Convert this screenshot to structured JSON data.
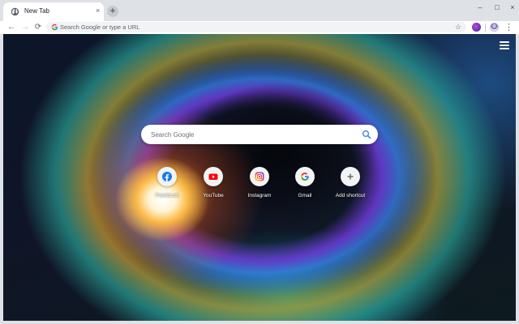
{
  "browser": {
    "tab": {
      "title": "New Tab",
      "close": "×"
    },
    "new_tab": "+",
    "window_controls": {
      "minimize": "–",
      "maximize": "□",
      "close": "×"
    },
    "nav": {
      "back": "←",
      "forward": "→",
      "reload": "⟳"
    },
    "omnibox": {
      "placeholder": "Search Google or type a URL",
      "star": "☆"
    },
    "menu": "⋮"
  },
  "newtab_page": {
    "search": {
      "placeholder": "Search Google"
    },
    "shortcuts": [
      {
        "label": "Facebook",
        "icon": "facebook-icon",
        "color": "#1877f2"
      },
      {
        "label": "YouTube",
        "icon": "youtube-icon",
        "color": "#ff0000"
      },
      {
        "label": "Instagram",
        "icon": "instagram-icon",
        "color": "#c13584"
      },
      {
        "label": "Gmail",
        "icon": "google-g-icon",
        "color": "#4285f4"
      },
      {
        "label": "Add shortcut",
        "icon": "plus-icon",
        "color": "#5f6368"
      }
    ]
  }
}
